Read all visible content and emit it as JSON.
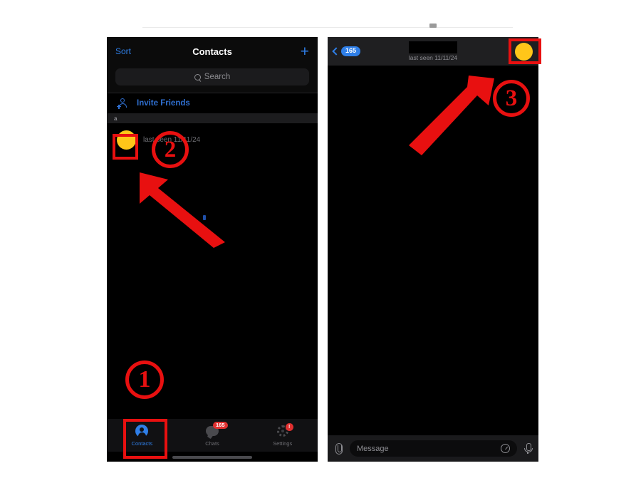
{
  "left_phone": {
    "navbar": {
      "sort_label": "Sort",
      "title": "Contacts",
      "add_icon": "+"
    },
    "search": {
      "placeholder": "Search",
      "icon": "search-icon"
    },
    "invite_row": {
      "label": "Invite Friends",
      "icon": "person-plus-icon"
    },
    "section_header": {
      "letter": "a"
    },
    "contact_row": {
      "avatar": "yellow-avatar",
      "subtitle": "last seen 11/11/24"
    },
    "tabbar": [
      {
        "label": "Contacts",
        "icon": "contacts-icon",
        "active": true,
        "badge": ""
      },
      {
        "label": "Chats",
        "icon": "chats-icon",
        "active": false,
        "badge": "165"
      },
      {
        "label": "Settings",
        "icon": "settings-icon",
        "active": false,
        "badge": "!"
      }
    ]
  },
  "right_phone": {
    "navbar": {
      "back_badge": "165",
      "back_icon": "chevron-left-icon",
      "contact_name": "",
      "last_seen": "last seen 11/11/24",
      "avatar": "yellow-avatar"
    },
    "input_bar": {
      "attach_icon": "paperclip-icon",
      "placeholder": "Message",
      "timer_icon": "timer-icon",
      "mic_icon": "microphone-icon"
    }
  },
  "annotations": {
    "step_one": "1",
    "step_two": "2",
    "step_three": "3",
    "accent_color": "#e81010"
  },
  "colors": {
    "avatar_yellow": "#ffc619",
    "accent_blue": "#2f7fe8",
    "badge_red": "#e03030",
    "annotation_red": "#e81010",
    "background": "#000000"
  }
}
